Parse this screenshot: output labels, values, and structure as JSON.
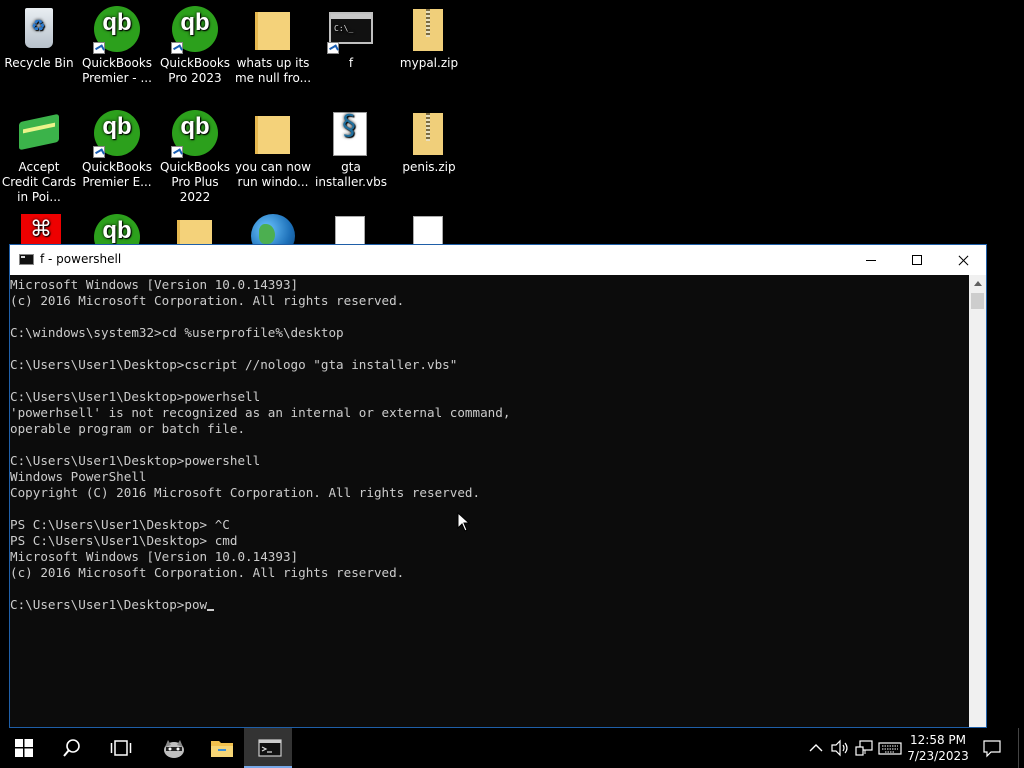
{
  "desktop": {
    "icons": [
      {
        "label": "Recycle Bin",
        "icon": "recycle-bin-icon"
      },
      {
        "label": "QuickBooks Premier - ...",
        "icon": "quickbooks-icon"
      },
      {
        "label": "QuickBooks Pro 2023",
        "icon": "quickbooks-icon"
      },
      {
        "label": "whats up its me null fro...",
        "icon": "folder-icon"
      },
      {
        "label": "f",
        "icon": "cmd-shortcut-icon"
      },
      {
        "label": "mypal.zip",
        "icon": "zip-folder-icon"
      },
      {
        "label": "Accept Credit Cards in Poi...",
        "icon": "credit-card-icon"
      },
      {
        "label": "QuickBooks Premier E...",
        "icon": "quickbooks-icon"
      },
      {
        "label": "QuickBooks Pro Plus 2022",
        "icon": "quickbooks-icon"
      },
      {
        "label": "you can now run windo...",
        "icon": "folder-icon"
      },
      {
        "label": "gta installer.vbs",
        "icon": "vbs-script-icon"
      },
      {
        "label": "penis.zip",
        "icon": "zip-folder-icon"
      }
    ],
    "qb_glyph": "qb",
    "cmd_glyph": "C:\\_"
  },
  "console": {
    "title": "f - powershell",
    "lines": [
      "Microsoft Windows [Version 10.0.14393]",
      "(c) 2016 Microsoft Corporation. All rights reserved.",
      "",
      "C:\\windows\\system32>cd %userprofile%\\desktop",
      "",
      "C:\\Users\\User1\\Desktop>cscript //nologo \"gta installer.vbs\"",
      "",
      "C:\\Users\\User1\\Desktop>powerhsell",
      "'powerhsell' is not recognized as an internal or external command,",
      "operable program or batch file.",
      "",
      "C:\\Users\\User1\\Desktop>powershell",
      "Windows PowerShell",
      "Copyright (C) 2016 Microsoft Corporation. All rights reserved.",
      "",
      "PS C:\\Users\\User1\\Desktop> ^C",
      "PS C:\\Users\\User1\\Desktop> cmd",
      "Microsoft Windows [Version 10.0.14393]",
      "(c) 2016 Microsoft Corporation. All rights reserved.",
      ""
    ],
    "current_input": "C:\\Users\\User1\\Desktop>pow"
  },
  "taskbar": {
    "time": "12:58 PM",
    "date": "7/23/2023"
  }
}
